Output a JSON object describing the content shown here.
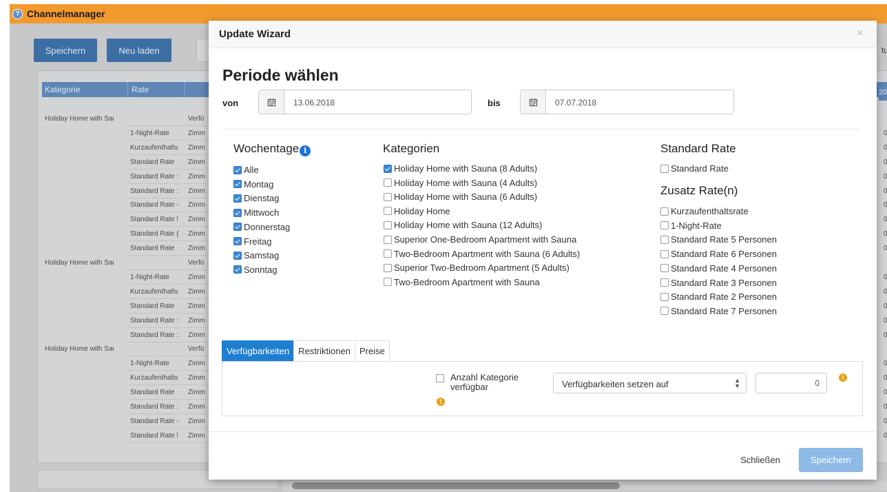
{
  "app": {
    "title": "Channelmanager",
    "toolbar": {
      "save": "Speichern",
      "reload": "Neu laden"
    },
    "grid": {
      "headers": [
        "Kategorie",
        "Rate"
      ],
      "rows": [
        {
          "cat": "Holiday Home with Sau",
          "rate": "",
          "unit": "Verfü",
          "last": ""
        },
        {
          "cat": "",
          "rate": "1-Night-Rate",
          "unit": "Zimm",
          "last": "0"
        },
        {
          "cat": "",
          "rate": "Kurzaufenthalts",
          "unit": "Zimm",
          "last": "0"
        },
        {
          "cat": "",
          "rate": "Standard Rate",
          "unit": "Zimm",
          "last": "0"
        },
        {
          "cat": "",
          "rate": "Standard Rate :",
          "unit": "Zimm",
          "last": "0"
        },
        {
          "cat": "",
          "rate": "Standard Rate :",
          "unit": "Zimm",
          "last": "0"
        },
        {
          "cat": "",
          "rate": "Standard Rate -",
          "unit": "Zimm",
          "last": "0"
        },
        {
          "cat": "",
          "rate": "Standard Rate !",
          "unit": "Zimm",
          "last": "0"
        },
        {
          "cat": "",
          "rate": "Standard Rate (",
          "unit": "Zimm",
          "last": "0"
        },
        {
          "cat": "",
          "rate": "Standard Rate",
          "unit": "Zimm",
          "last": "0"
        },
        {
          "cat": "Holiday Home with Sau",
          "rate": "",
          "unit": "Verfü",
          "last": ""
        },
        {
          "cat": "",
          "rate": "1-Night-Rate",
          "unit": "Zimm",
          "last": "0"
        },
        {
          "cat": "",
          "rate": "Kurzaufenthalts",
          "unit": "Zimm",
          "last": "0"
        },
        {
          "cat": "",
          "rate": "Standard Rate",
          "unit": "Zimm",
          "last": "0"
        },
        {
          "cat": "",
          "rate": "Standard Rate :",
          "unit": "Zimm",
          "last": "0"
        },
        {
          "cat": "",
          "rate": "Standard Rate :",
          "unit": "Zimm",
          "last": "0"
        },
        {
          "cat": "Holiday Home with Sau",
          "rate": "",
          "unit": "Verfü",
          "last": ""
        },
        {
          "cat": "",
          "rate": "1-Night-Rate",
          "unit": "Zimm",
          "last": "0"
        },
        {
          "cat": "",
          "rate": "Kurzaufenthalts",
          "unit": "Zimm",
          "last": "0"
        },
        {
          "cat": "",
          "rate": "Standard Rate",
          "unit": "Zimm",
          "last": "0"
        },
        {
          "cat": "",
          "rate": "Standard Rate :",
          "unit": "Zimm",
          "last": "0"
        },
        {
          "cat": "",
          "rate": "Standard Rate -",
          "unit": "Zimm",
          "last": "0"
        },
        {
          "cat": "",
          "rate": "Standard Rate !",
          "unit": "Zimm",
          "last": "0"
        }
      ],
      "right_ghost": "tu",
      "right_num": "20"
    }
  },
  "modal": {
    "title": "Update Wizard",
    "close_symbol": "×",
    "period_title": "Periode wählen",
    "from_label": "von",
    "from_date": "13.06.2018",
    "to_label": "bis",
    "to_date": "07.07.2018",
    "weekdays": {
      "title": "Wochentage",
      "info": "i",
      "items": [
        {
          "label": "Alle",
          "checked": true
        },
        {
          "label": "Montag",
          "checked": true
        },
        {
          "label": "Dienstag",
          "checked": true
        },
        {
          "label": "Mittwoch",
          "checked": true
        },
        {
          "label": "Donnerstag",
          "checked": true
        },
        {
          "label": "Freitag",
          "checked": true
        },
        {
          "label": "Samstag",
          "checked": true
        },
        {
          "label": "Sonntag",
          "checked": true
        }
      ]
    },
    "categories": {
      "title": "Kategorien",
      "items": [
        {
          "label": "Holiday Home with Sauna (8 Adults)",
          "checked": true
        },
        {
          "label": "Holiday Home with Sauna (4 Adults)",
          "checked": false
        },
        {
          "label": "Holiday Home with Sauna (6 Adults)",
          "checked": false
        },
        {
          "label": "Holiday Home",
          "checked": false
        },
        {
          "label": "Holiday Home with Sauna (12 Adults)",
          "checked": false
        },
        {
          "label": "Superior One-Bedroom Apartment with Sauna",
          "checked": false
        },
        {
          "label": "Two-Bedroom Apartment with Sauna (6 Adults)",
          "checked": false
        },
        {
          "label": "Superior Two-Bedroom Apartment (5 Adults)",
          "checked": false
        },
        {
          "label": "Two-Bedroom Apartment with Sauna",
          "checked": false
        }
      ]
    },
    "standard_rate": {
      "title": "Standard Rate",
      "items": [
        {
          "label": "Standard Rate",
          "checked": false
        }
      ]
    },
    "extra_rates": {
      "title": "Zusatz Rate(n)",
      "items": [
        {
          "label": "Kurzaufenthaltsrate",
          "checked": false
        },
        {
          "label": "1-Night-Rate",
          "checked": false
        },
        {
          "label": "Standard Rate 5 Personen",
          "checked": false
        },
        {
          "label": "Standard Rate 6 Personen",
          "checked": false
        },
        {
          "label": "Standard Rate 4 Personen",
          "checked": false
        },
        {
          "label": "Standard Rate 3 Personen",
          "checked": false
        },
        {
          "label": "Standard Rate 2 Personen",
          "checked": false
        },
        {
          "label": "Standard Rate 7 Personen",
          "checked": false
        }
      ]
    },
    "tabs": [
      {
        "label": "Verfügbarkeiten",
        "active": true
      },
      {
        "label": "Restriktionen",
        "active": false
      },
      {
        "label": "Preise",
        "active": false
      }
    ],
    "availability": {
      "checkbox_label": "Anzahl Kategorie verfügbar",
      "checked": false,
      "info": "!",
      "select_value": "Verfügbarkeiten setzen auf",
      "number_value": "0"
    },
    "footer": {
      "close": "Schließen",
      "save": "Speichern"
    }
  },
  "colors": {
    "titlebar": "#f39a2c",
    "primary": "#1e7fd1",
    "save_button": "#8ebbe6",
    "checkbox_on": "#3b88d6",
    "info_orange": "#e9a11a"
  }
}
